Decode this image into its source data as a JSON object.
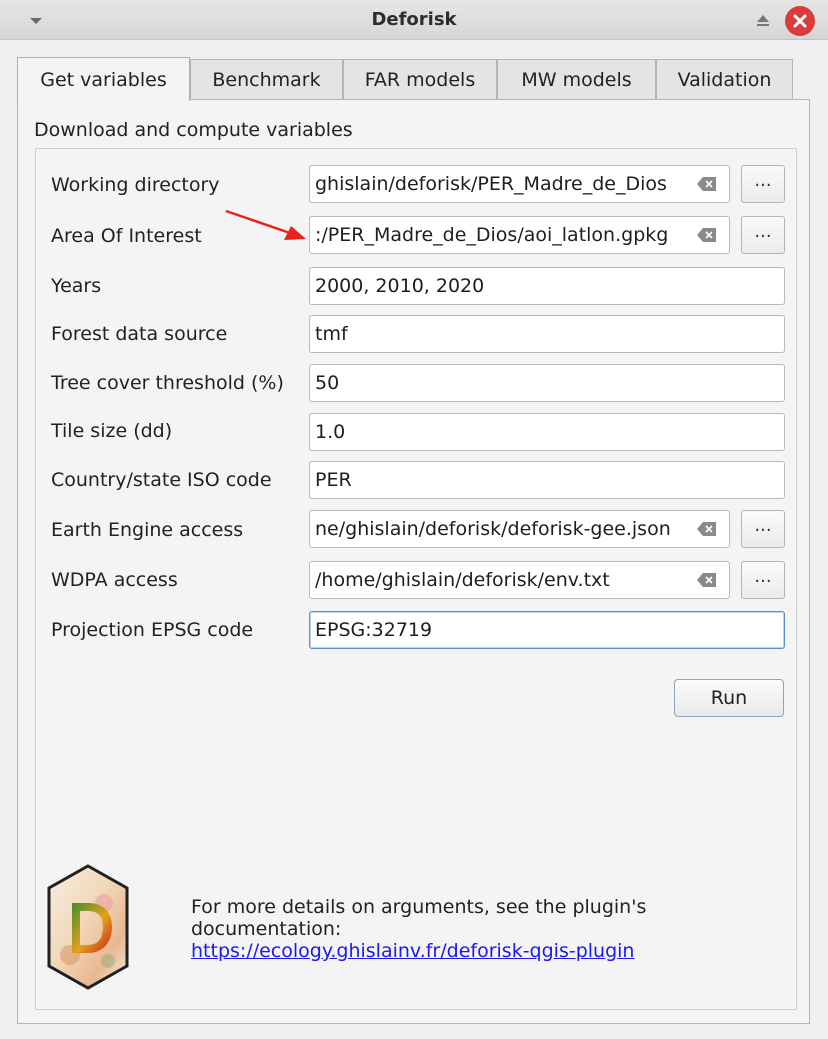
{
  "window": {
    "title": "Deforisk"
  },
  "tabs": [
    {
      "label": "Get variables",
      "active": true
    },
    {
      "label": "Benchmark"
    },
    {
      "label": "FAR models"
    },
    {
      "label": "MW models"
    },
    {
      "label": "Validation"
    }
  ],
  "section": {
    "heading": "Download and compute variables"
  },
  "fields": [
    {
      "label": "Working directory",
      "value": "ghislain/deforisk/PER_Madre_de_Dios"
    },
    {
      "label": "Area Of Interest",
      "value": ":/PER_Madre_de_Dios/aoi_latlon.gpkg"
    },
    {
      "label": "Years",
      "value": "2000, 2010, 2020"
    },
    {
      "label": "Forest data source",
      "value": "tmf"
    },
    {
      "label": "Tree cover threshold (%)",
      "value": "50"
    },
    {
      "label": "Tile size (dd)",
      "value": "1.0"
    },
    {
      "label": "Country/state ISO code",
      "value": "PER"
    },
    {
      "label": "Earth Engine access",
      "value": "ne/ghislain/deforisk/deforisk-gee.json"
    },
    {
      "label": "WDPA access",
      "value": "/home/ghislain/deforisk/env.txt"
    },
    {
      "label": "Projection EPSG code",
      "value": "EPSG:32719"
    }
  ],
  "browse_label": "...",
  "run_label": "Run",
  "footer": {
    "text_line1": "For more details on arguments, see the plugin's",
    "text_line2": "documentation:",
    "link": "https://ecology.ghislainv.fr/deforisk-qgis-plugin"
  },
  "icons": {
    "window_menu": "chevron-down-icon",
    "shade": "eject-icon",
    "close": "close-icon",
    "clear": "backspace-clear-icon",
    "logo": "deforisk-hexagon-logo"
  },
  "colors": {
    "close": "#d93c3c",
    "link": "#1a1aee",
    "annotation_arrow": "#e8231d",
    "focus": "#5d8ed0"
  }
}
